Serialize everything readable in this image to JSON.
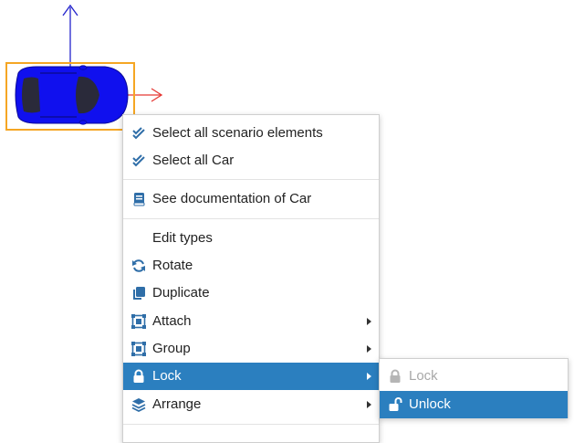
{
  "menu": {
    "items": [
      {
        "label": "Select all scenario elements",
        "icon": "double-check-icon"
      },
      {
        "label": "Select all Car",
        "icon": "double-check-icon"
      },
      {
        "label": "See documentation of Car",
        "icon": "book-icon"
      },
      {
        "label": "Edit types",
        "icon": ""
      },
      {
        "label": "Rotate",
        "icon": "rotate-icon"
      },
      {
        "label": "Duplicate",
        "icon": "copy-icon"
      },
      {
        "label": "Attach",
        "icon": "attach-frame-icon"
      },
      {
        "label": "Group",
        "icon": "group-frame-icon"
      },
      {
        "label": "Lock",
        "icon": "lock-icon"
      },
      {
        "label": "Arrange",
        "icon": "layers-icon"
      }
    ]
  },
  "submenu": {
    "items": [
      {
        "label": "Lock",
        "icon": "lock-icon",
        "disabled": true
      },
      {
        "label": "Unlock",
        "icon": "unlock-icon",
        "selected": true
      }
    ]
  },
  "colors": {
    "accent": "#2b7fbf",
    "icon_blue": "#2f6ea8",
    "car_body": "#1010ee",
    "selection_box": "#f5a623",
    "axis_x": "#e53935",
    "axis_y": "#2222cc"
  }
}
